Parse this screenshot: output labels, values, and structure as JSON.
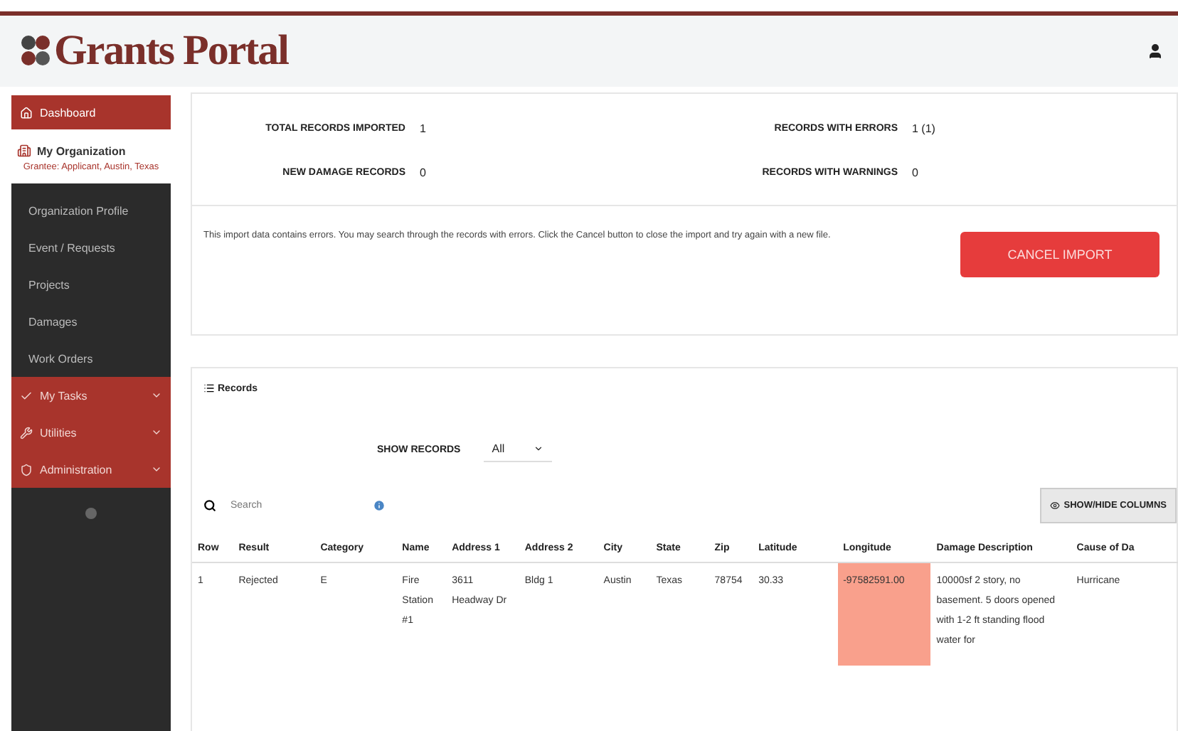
{
  "header": {
    "logo": "Grants Portal"
  },
  "sidebar": {
    "dashboard": "Dashboard",
    "organization": {
      "title": "My Organization",
      "subtitle": "Grantee: Applicant, Austin, Texas"
    },
    "menu": [
      {
        "label": "Organization Profile",
        "kind": "link"
      },
      {
        "label": "Event / Requests",
        "kind": "link"
      },
      {
        "label": "Projects",
        "kind": "link"
      },
      {
        "label": "Damages",
        "kind": "link"
      },
      {
        "label": "Work Orders",
        "kind": "link"
      },
      {
        "label": "My Tasks",
        "kind": "group"
      },
      {
        "label": "Utilities",
        "kind": "group"
      },
      {
        "label": "Administration",
        "kind": "group"
      }
    ]
  },
  "summary": {
    "stats": [
      {
        "label": "TOTAL RECORDS IMPORTED",
        "value": "1"
      },
      {
        "label": "RECORDS WITH ERRORS",
        "value": "1 (1)"
      },
      {
        "label": "NEW DAMAGE RECORDS",
        "value": "0"
      },
      {
        "label": "RECORDS WITH WARNINGS",
        "value": "0"
      }
    ],
    "message": "This import data contains errors. You may search through the records with errors. Click the Cancel button to close the import and try again with a new file.",
    "cancel_button": "CANCEL IMPORT"
  },
  "records": {
    "title": "Records",
    "show_records_label": "SHOW RECORDS",
    "show_records_value": "All",
    "search": {
      "placeholder": "Search"
    },
    "columns_button": "SHOW/HIDE COLUMNS",
    "table": {
      "columns": [
        "Row",
        "Result",
        "Category",
        "Name",
        "Address 1",
        "Address 2",
        "City",
        "State",
        "Zip",
        "Latitude",
        "Longitude",
        "Damage Description",
        "Cause of Da"
      ],
      "rows": [
        {
          "cells": [
            {
              "text": "1",
              "error": false
            },
            {
              "text": "Rejected",
              "error": false
            },
            {
              "text": "E",
              "error": false
            },
            {
              "text": "Fire Station #1",
              "error": false
            },
            {
              "text": "3611 Headway Dr",
              "error": false
            },
            {
              "text": "Bldg 1",
              "error": false
            },
            {
              "text": "Austin",
              "error": false
            },
            {
              "text": "Texas",
              "error": false
            },
            {
              "text": "78754",
              "error": false
            },
            {
              "text": "30.33",
              "error": false
            },
            {
              "text": "-97582591.00",
              "error": true
            },
            {
              "text": "10000sf 2 story, no basement. 5 doors opened with 1-2 ft standing flood water for",
              "error": false
            },
            {
              "text": "Hurricane",
              "error": false
            }
          ]
        }
      ]
    }
  }
}
